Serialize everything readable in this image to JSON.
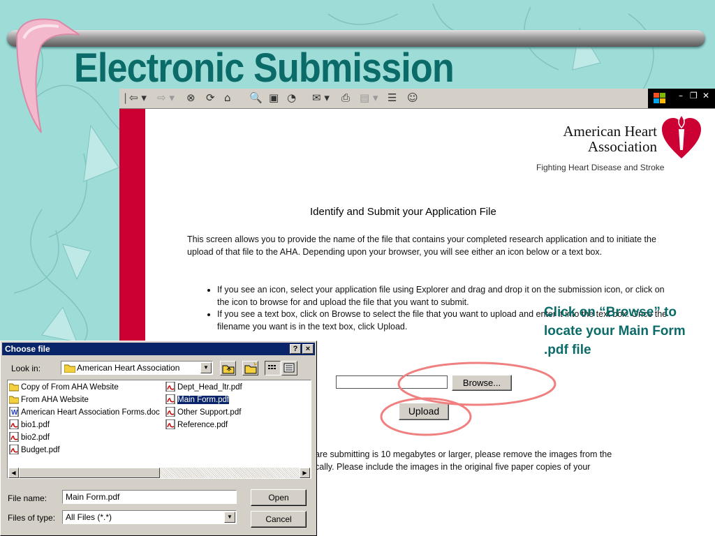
{
  "slide": {
    "title": "Electronic Submission",
    "callout": "Click on “Browse” to locate your Main Form .pdf file"
  },
  "browser": {
    "toolbar_icons": [
      "back-icon",
      "forward-icon",
      "stop-icon",
      "refresh-icon",
      "home-icon",
      "search-icon",
      "favorites-icon",
      "history-icon",
      "mail-icon",
      "print-icon",
      "edit-icon",
      "discuss-icon",
      "messenger-icon"
    ],
    "window_controls": [
      "–",
      "❐",
      "✕"
    ]
  },
  "page": {
    "org_name_line1": "American Heart",
    "org_name_line2": "Association",
    "tagline": "Fighting Heart Disease and Stroke",
    "heading": "Identify and Submit your Application File",
    "intro": "This screen allows you to provide the name of the file that contains your completed research application and to initiate the upload of that file to the AHA. Depending upon your browser, you will see either an icon below or a text box.",
    "bullets": [
      "If you see an icon, select your application file using Explorer and drag and drop it on the submission icon, or click on the icon to browse for and upload the file that you want to submit.",
      "If you see a text box, click on Browse to select the file that you want to upload and enter it into the text box. Once the filename you want is in the text box, click Upload."
    ],
    "browse_label": "Browse...",
    "upload_label": "Upload",
    "size_note_line1": "are submitting is 10 megabytes or larger, please remove the images from the",
    "size_note_line2": "cally. Please include the images in the original five paper copies of your"
  },
  "dialog": {
    "title": "Choose file",
    "look_in_label": "Look in:",
    "look_in_value": "American Heart Association",
    "files_col1": [
      {
        "name": "Copy of From AHA Website",
        "type": "folder"
      },
      {
        "name": "From AHA Website",
        "type": "folder"
      },
      {
        "name": "American Heart Association Forms.doc",
        "type": "doc"
      },
      {
        "name": "bio1.pdf",
        "type": "pdf"
      },
      {
        "name": "bio2.pdf",
        "type": "pdf"
      },
      {
        "name": "Budget.pdf",
        "type": "pdf"
      }
    ],
    "files_col2": [
      {
        "name": "Dept_Head_ltr.pdf",
        "type": "pdf"
      },
      {
        "name": "Main Form.pdf",
        "type": "pdf",
        "selected": true
      },
      {
        "name": "Other Support.pdf",
        "type": "pdf"
      },
      {
        "name": "Reference.pdf",
        "type": "pdf"
      }
    ],
    "filename_label": "File name:",
    "filename_value": "Main Form.pdf",
    "filetype_label": "Files of type:",
    "filetype_value": "All Files (*.*)",
    "open_label": "Open",
    "cancel_label": "Cancel",
    "help_label": "?",
    "close_label": "×"
  },
  "colors": {
    "title": "#0b6b68",
    "background": "#9edcd8",
    "aha_red": "#cc0033",
    "highlight_ellipse": "#f08080",
    "dialog_titlebar": "#0a246a"
  }
}
